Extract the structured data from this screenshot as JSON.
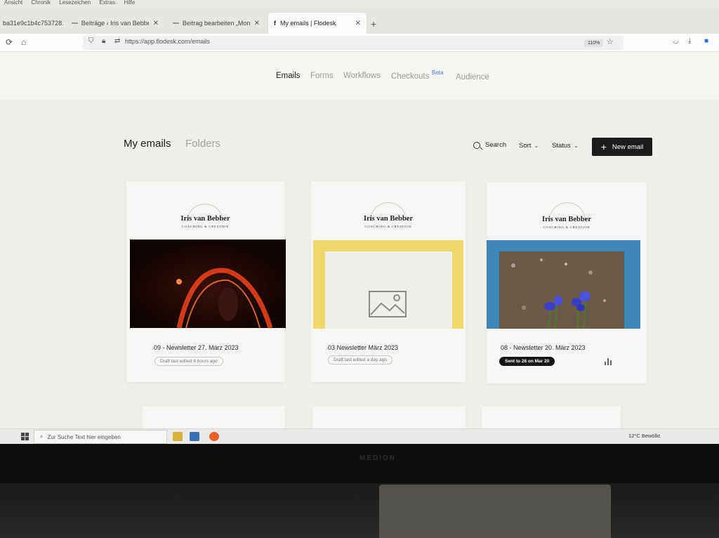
{
  "browser": {
    "menu": [
      "Ansicht",
      "Chronik",
      "Lesezeichen",
      "Extras",
      "Hilfe"
    ],
    "tabs": [
      {
        "label": "ba31e9c1b4c753728…"
      },
      {
        "label": "Beiträge ‹ Iris van Bebber — Wo"
      },
      {
        "label": "Beitrag bearbeiten „Monatsrück"
      },
      {
        "label": "My emails | Flodesk"
      }
    ],
    "new_tab": "+",
    "url": "https://app.flodesk.com/emails",
    "zoom": "110%"
  },
  "app": {
    "nav": [
      "Emails",
      "Forms",
      "Workflows",
      "Checkouts",
      "Audience"
    ],
    "beta_label": "Beta",
    "title": "My emails",
    "folders_tab": "Folders",
    "toolbar": {
      "search": "Search",
      "sort": "Sort",
      "status": "Status",
      "new_email": "New email"
    }
  },
  "emails": [
    {
      "brand": "Iris van Bebber",
      "brand_sub": "COACHING & CREATION",
      "title": "09 - Newsletter 27. März 2023",
      "status": "Draft last edited 6 hours ago",
      "frame_color": "#1a0b08"
    },
    {
      "brand": "Iris van Bebber",
      "brand_sub": "COACHING & CREATION",
      "title": "03 Newsletter März 2023",
      "status": "Draft last edited a day ago",
      "frame_color": "#f1d86a"
    },
    {
      "brand": "Iris van Bebber",
      "brand_sub": "COACHING & CREATION",
      "title": "08 - Newsletter 20. März 2023",
      "status": "Sent to 26 on Mar 20",
      "frame_color": "#3c86b8"
    }
  ],
  "taskbar": {
    "search_placeholder": "Zur Suche Text hier eingeben",
    "weather": "12°C  Bewölkt"
  },
  "monitor_brand": "MEDION"
}
